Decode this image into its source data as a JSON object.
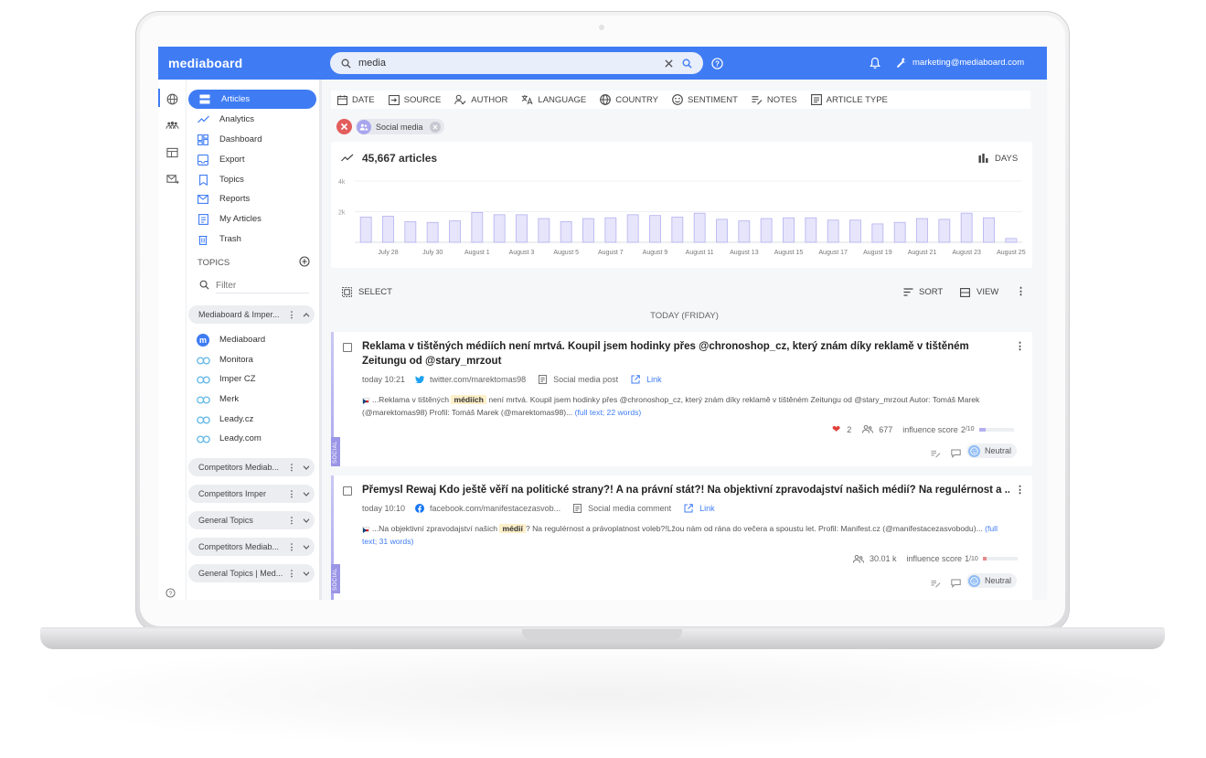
{
  "app": {
    "logo": "mediaboard",
    "user_email": "marketing@mediaboard.com"
  },
  "search": {
    "value": "media"
  },
  "nav": {
    "items": [
      {
        "label": "Articles",
        "icon": "articles-icon",
        "active": true
      },
      {
        "label": "Analytics",
        "icon": "analytics-icon"
      },
      {
        "label": "Dashboard",
        "icon": "dashboard-icon"
      },
      {
        "label": "Export",
        "icon": "export-icon"
      },
      {
        "label": "Topics",
        "icon": "bookmark-icon"
      },
      {
        "label": "Reports",
        "icon": "mail-icon"
      },
      {
        "label": "My Articles",
        "icon": "my-articles-icon"
      },
      {
        "label": "Trash",
        "icon": "trash-icon"
      }
    ]
  },
  "topics": {
    "header": "TOPICS",
    "filter_placeholder": "Filter",
    "groups": [
      {
        "label": "Mediaboard & Imper...",
        "expanded": true,
        "items": [
          "Mediaboard",
          "Monitora",
          "Imper CZ",
          "Merk",
          "Leady.cz",
          "Leady.com"
        ]
      },
      {
        "label": "Competitors Mediab..."
      },
      {
        "label": "Competitors Imper"
      },
      {
        "label": "General Topics"
      },
      {
        "label": "Competitors Mediab..."
      },
      {
        "label": "General Topics | Med..."
      }
    ]
  },
  "filters": [
    "DATE",
    "SOURCE",
    "AUTHOR",
    "LANGUAGE",
    "COUNTRY",
    "SENTIMENT",
    "NOTES",
    "ARTICLE TYPE"
  ],
  "active_filter_chip": "Social media",
  "chart": {
    "total_label": "45,667 articles",
    "period_toggle": "DAYS"
  },
  "chart_data": {
    "type": "bar",
    "x": [
      "July 27",
      "July 28",
      "July 29",
      "July 30",
      "July 31",
      "August 1",
      "August 2",
      "August 3",
      "August 4",
      "August 5",
      "August 6",
      "August 7",
      "August 8",
      "August 9",
      "August 10",
      "August 11",
      "August 12",
      "August 13",
      "August 14",
      "August 15",
      "August 16",
      "August 17",
      "August 18",
      "August 19",
      "August 20",
      "August 21",
      "August 22",
      "August 23",
      "August 24",
      "August 25"
    ],
    "tick_labels": [
      "July 28",
      "July 30",
      "August 1",
      "August 3",
      "August 5",
      "August 7",
      "August 9",
      "August 11",
      "August 13",
      "August 15",
      "August 17",
      "August 19",
      "August 21",
      "August 23",
      "August 25"
    ],
    "values": [
      1650,
      1700,
      1350,
      1300,
      1400,
      1950,
      1800,
      1800,
      1550,
      1350,
      1550,
      1600,
      1800,
      1750,
      1650,
      1900,
      1500,
      1400,
      1550,
      1600,
      1600,
      1450,
      1450,
      1200,
      1300,
      1550,
      1500,
      1900,
      1600,
      250
    ],
    "ylim": [
      0,
      4000
    ],
    "yticks": [
      "4k",
      "2k"
    ],
    "grid": true,
    "colors": {
      "bar_fill": "#e6e5fb",
      "bar_stroke": "#b4b1ef"
    }
  },
  "list_toolbar": {
    "select": "SELECT",
    "sort": "SORT",
    "view": "VIEW",
    "day_header": "TODAY (FRIDAY)"
  },
  "articles": [
    {
      "title": "Reklama v tištěných médiích není mrtvá. Koupil jsem hodinky přes @chronoshop_cz, který znám díky reklamě v tištěném Zeitungu od @stary_mrzout",
      "time": "today 10:21",
      "source": "twitter.com/marektomas98",
      "type": "Social media post",
      "link": "Link",
      "snippet_pre": "...Reklama v tištěných",
      "snippet_hl": "médiích",
      "snippet_post": "není mrtvá. Koupil jsem hodinky přes @chronoshop_cz, který znám díky reklamě v tištěném Zeitungu od @stary_mrzout Autor: Tomáš Marek (@marektomas98) Profil: Tomáš Marek (@marektomas98)...",
      "full_text": "(full text; 22 words)",
      "likes": "2",
      "reach": "677",
      "influence_label": "influence score",
      "influence_value": "2",
      "influence_max": "/10",
      "influence": 0.2,
      "sentiment": "Neutral",
      "tag": "SOCIAL"
    },
    {
      "title": "Přemysl Rewaj Kdo ještě věří na politické strany?! A na právní stát?! Na objektivní zpravodajství našich médií? Na regulérnost a ...",
      "time": "today 10:10",
      "source": "facebook.com/manifestacezasvob...",
      "type": "Social media comment",
      "link": "Link",
      "snippet_pre": "...Na objektivní zpravodajství našich",
      "snippet_hl": "médií",
      "snippet_post": "? Na regulérnost a právoplatnost voleb?!Lžou nám od rána do večera a spoustu let. Profil: Manifest.cz (@manifestacezasvobodu)...",
      "full_text": "(full text; 31 words)",
      "reach": "30.01 k",
      "influence_label": "influence score",
      "influence_value": "1",
      "influence_max": "/10",
      "influence": 0.1,
      "sentiment": "Neutral",
      "tag": "SOCIAL"
    }
  ]
}
